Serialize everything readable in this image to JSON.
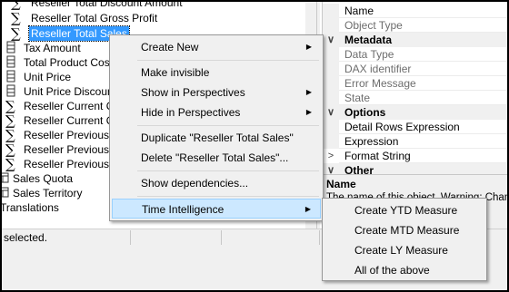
{
  "tree": {
    "items": [
      {
        "icon": "sigma",
        "label": "Reseller Total Discount Amount"
      },
      {
        "icon": "sigma",
        "label": "Reseller Total Gross Profit"
      },
      {
        "icon": "sigma",
        "label": "Reseller Total Sales",
        "selected": true
      },
      {
        "icon": "column",
        "label": "Tax Amount"
      },
      {
        "icon": "column",
        "label": "Total Product Cost"
      },
      {
        "icon": "column",
        "label": "Unit Price"
      },
      {
        "icon": "column",
        "label": "Unit Price Discount"
      },
      {
        "icon": "sigma",
        "label": "Reseller Current Q"
      },
      {
        "icon": "sigma",
        "label": "Reseller Current Q"
      },
      {
        "icon": "sigma",
        "label": "Reseller Previous"
      },
      {
        "icon": "sigma",
        "label": "Reseller Previous"
      },
      {
        "icon": "sigma",
        "label": "Reseller Previous"
      },
      {
        "icon": "table",
        "label": "Sales Quota"
      },
      {
        "icon": "table",
        "label": "Sales Territory"
      },
      {
        "icon": "none",
        "label": "Translations"
      }
    ]
  },
  "properties": {
    "rows": [
      {
        "kind": "prop",
        "label": "Name",
        "dim": false
      },
      {
        "kind": "prop",
        "label": "Object Type",
        "dim": true
      },
      {
        "kind": "header",
        "label": "Metadata",
        "glyph": "∨"
      },
      {
        "kind": "prop",
        "label": "Data Type",
        "dim": true
      },
      {
        "kind": "prop",
        "label": "DAX identifier",
        "dim": true
      },
      {
        "kind": "prop",
        "label": "Error Message",
        "dim": true
      },
      {
        "kind": "prop",
        "label": "State",
        "dim": true
      },
      {
        "kind": "header",
        "label": "Options",
        "glyph": "∨"
      },
      {
        "kind": "prop",
        "label": "Detail Rows Expression",
        "dim": false
      },
      {
        "kind": "prop",
        "label": "Expression",
        "dim": false
      },
      {
        "kind": "prop",
        "label": "Format String",
        "dim": false,
        "glyph": ">"
      },
      {
        "kind": "header",
        "label": "Other",
        "glyph": "∨"
      }
    ],
    "description": {
      "name": "Name",
      "text": "The name of this object. Warning: Changing"
    }
  },
  "status": {
    "selection": "selected."
  },
  "context_menu": {
    "items": [
      {
        "label": "Create New",
        "submenu": true
      },
      {
        "label": "Make invisible",
        "submenu": false
      },
      {
        "label": "Show in Perspectives",
        "submenu": true
      },
      {
        "label": "Hide in Perspectives",
        "submenu": true
      },
      {
        "label": "Duplicate \"Reseller Total Sales\"",
        "submenu": false
      },
      {
        "label": "Delete \"Reseller Total Sales\"...",
        "submenu": false
      },
      {
        "label": "Show dependencies...",
        "submenu": false
      },
      {
        "label": "Time Intelligence",
        "submenu": true,
        "active": true
      }
    ],
    "arrow_glyph": "▶"
  },
  "submenu": {
    "items": [
      {
        "label": "Create YTD Measure"
      },
      {
        "label": "Create MTD Measure"
      },
      {
        "label": "Create LY Measure"
      },
      {
        "label": "All of the above"
      }
    ]
  },
  "colors": {
    "selection": "#3399ff",
    "menu_highlight": "#cce8ff",
    "menu_highlight_border": "#99d1ff",
    "menu_bg": "#f0f0f0"
  }
}
